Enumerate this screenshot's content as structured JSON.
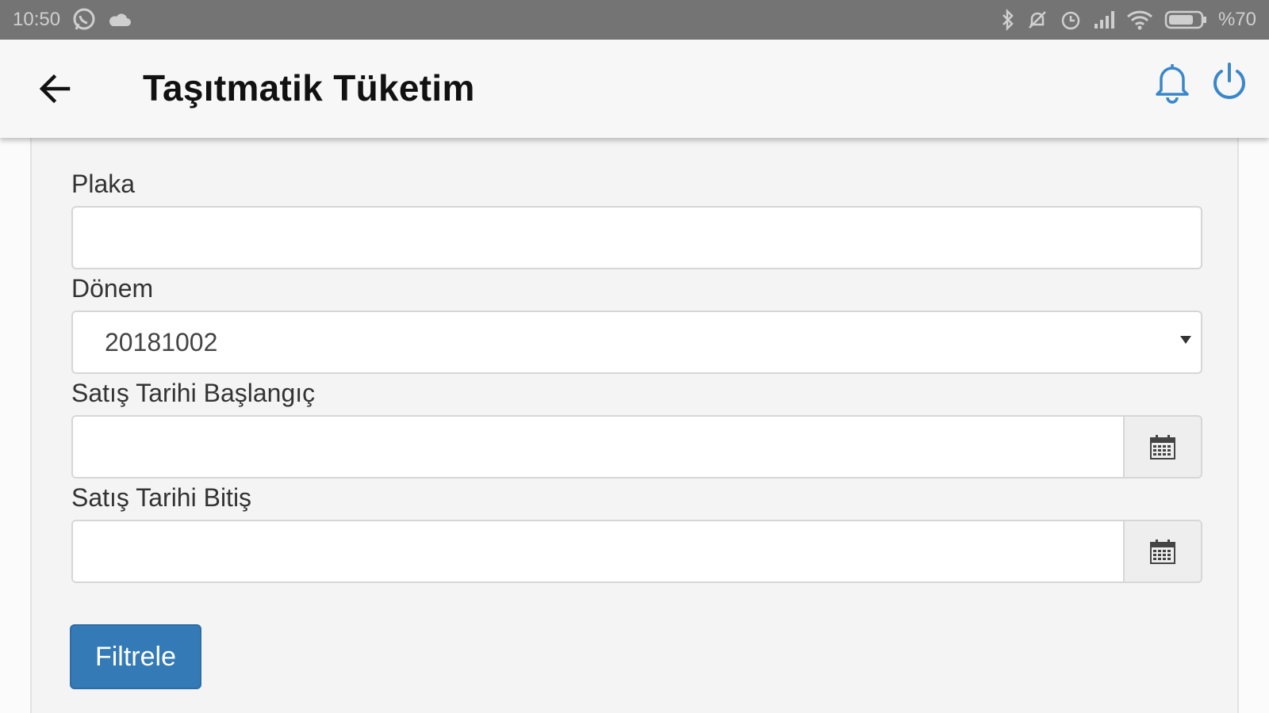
{
  "status_bar": {
    "time": "10:50",
    "battery_text": "%70",
    "left_icons": [
      "whatsapp-icon",
      "cloud-icon"
    ],
    "right_icons": [
      "bluetooth-icon",
      "notifications-off-icon",
      "alarm-icon",
      "signal-icon",
      "wifi-icon",
      "battery-icon"
    ]
  },
  "header": {
    "title": "Taşıtmatik Tüketim",
    "back_icon": "arrow-left-icon",
    "actions": [
      "bell-icon",
      "power-icon"
    ],
    "accent_color": "#3a87c9"
  },
  "form": {
    "plaka": {
      "label": "Plaka",
      "value": ""
    },
    "donem": {
      "label": "Dönem",
      "value": "20181002"
    },
    "start_date": {
      "label": "Satış Tarihi Başlangıç",
      "value": ""
    },
    "end_date": {
      "label": "Satış Tarihi Bitiş",
      "value": ""
    },
    "filter_button": {
      "label": "Filtrele",
      "color": "#337ab7"
    }
  }
}
